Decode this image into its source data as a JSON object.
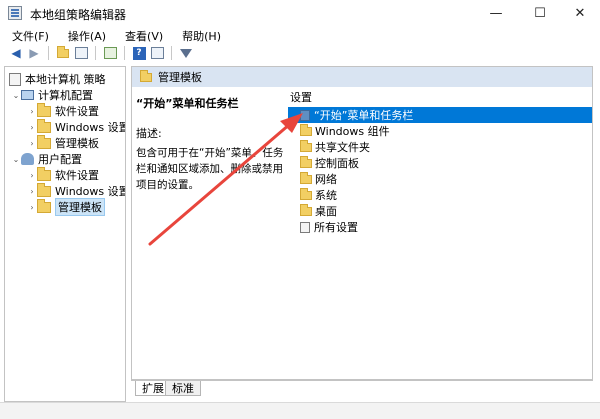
{
  "window": {
    "title": "本地组策略编辑器"
  },
  "menu": [
    "文件(F)",
    "操作(A)",
    "查看(V)",
    "帮助(H)"
  ],
  "tree": {
    "root": "本地计算机 策略",
    "computer_config": "计算机配置",
    "software_settings_1": "软件设置",
    "windows_settings_1": "Windows 设置",
    "admin_templates_1": "管理模板",
    "user_config": "用户配置",
    "software_settings_2": "软件设置",
    "windows_settings_2": "Windows 设置",
    "admin_templates_2": "管理模板"
  },
  "main": {
    "header": "管理模板",
    "desc_title": "“开始”菜单和任务栏",
    "desc_label": "描述:",
    "desc_body": "包含可用于在“开始”菜单、任务栏和通知区域添加、删除或禁用项目的设置。",
    "list_header": "设置",
    "items": [
      "“开始”菜单和任务栏",
      "Windows 组件",
      "共享文件夹",
      "控制面板",
      "网络",
      "系统",
      "桌面",
      "所有设置"
    ]
  },
  "tabs": {
    "extended": "扩展",
    "standard": "标准"
  },
  "colors": {
    "selection": "#0078d7",
    "annotation": "#e8453c",
    "header": "#d9e4f2"
  }
}
